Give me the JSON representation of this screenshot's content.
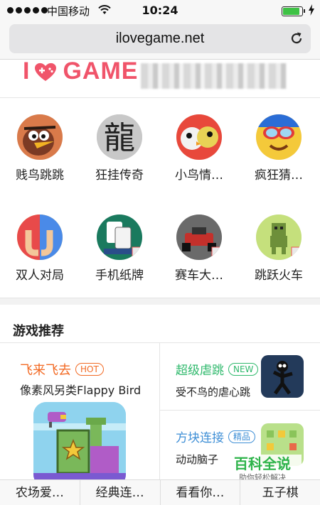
{
  "status_bar": {
    "carrier": "中国移动",
    "time": "10:24",
    "battery_level": 0.9
  },
  "browser": {
    "url": "ilovegame.net"
  },
  "logo": {
    "text": "GAME",
    "brand_color": "#f0546a"
  },
  "apps": [
    {
      "label": "贱鸟跳跳",
      "icon": "angry-bird-icon"
    },
    {
      "label": "狂挂传奇",
      "icon": "dragon-character-icon"
    },
    {
      "label": "小鸟情…",
      "icon": "bird-couple-icon"
    },
    {
      "label": "疯狂猜…",
      "icon": "goggles-face-icon"
    },
    {
      "label": "双人对局",
      "icon": "two-hands-icon"
    },
    {
      "label": "手机纸牌",
      "icon": "card-game-icon"
    },
    {
      "label": "赛车大…",
      "icon": "race-car-icon"
    },
    {
      "label": "跳跃火车",
      "icon": "pixel-robot-icon"
    }
  ],
  "recommend": {
    "title": "游戏推荐",
    "featured": {
      "name": "飞来飞去",
      "tag": "HOT",
      "desc": "像素风另类Flappy Bird"
    },
    "items": [
      {
        "name": "超级虐跳",
        "tag": "NEW",
        "desc": "受不鸟的虐心跳",
        "color": "#2fb96c"
      },
      {
        "name": "方块连接",
        "tag": "精品",
        "desc": "动动脑子",
        "color": "#3f8fd6"
      }
    ]
  },
  "bottom_tabs": [
    "农场爱…",
    "经典连…",
    "看看你…",
    "五子棋"
  ],
  "watermark": {
    "title": "百科全说",
    "subtitle": "助你轻松解决"
  }
}
